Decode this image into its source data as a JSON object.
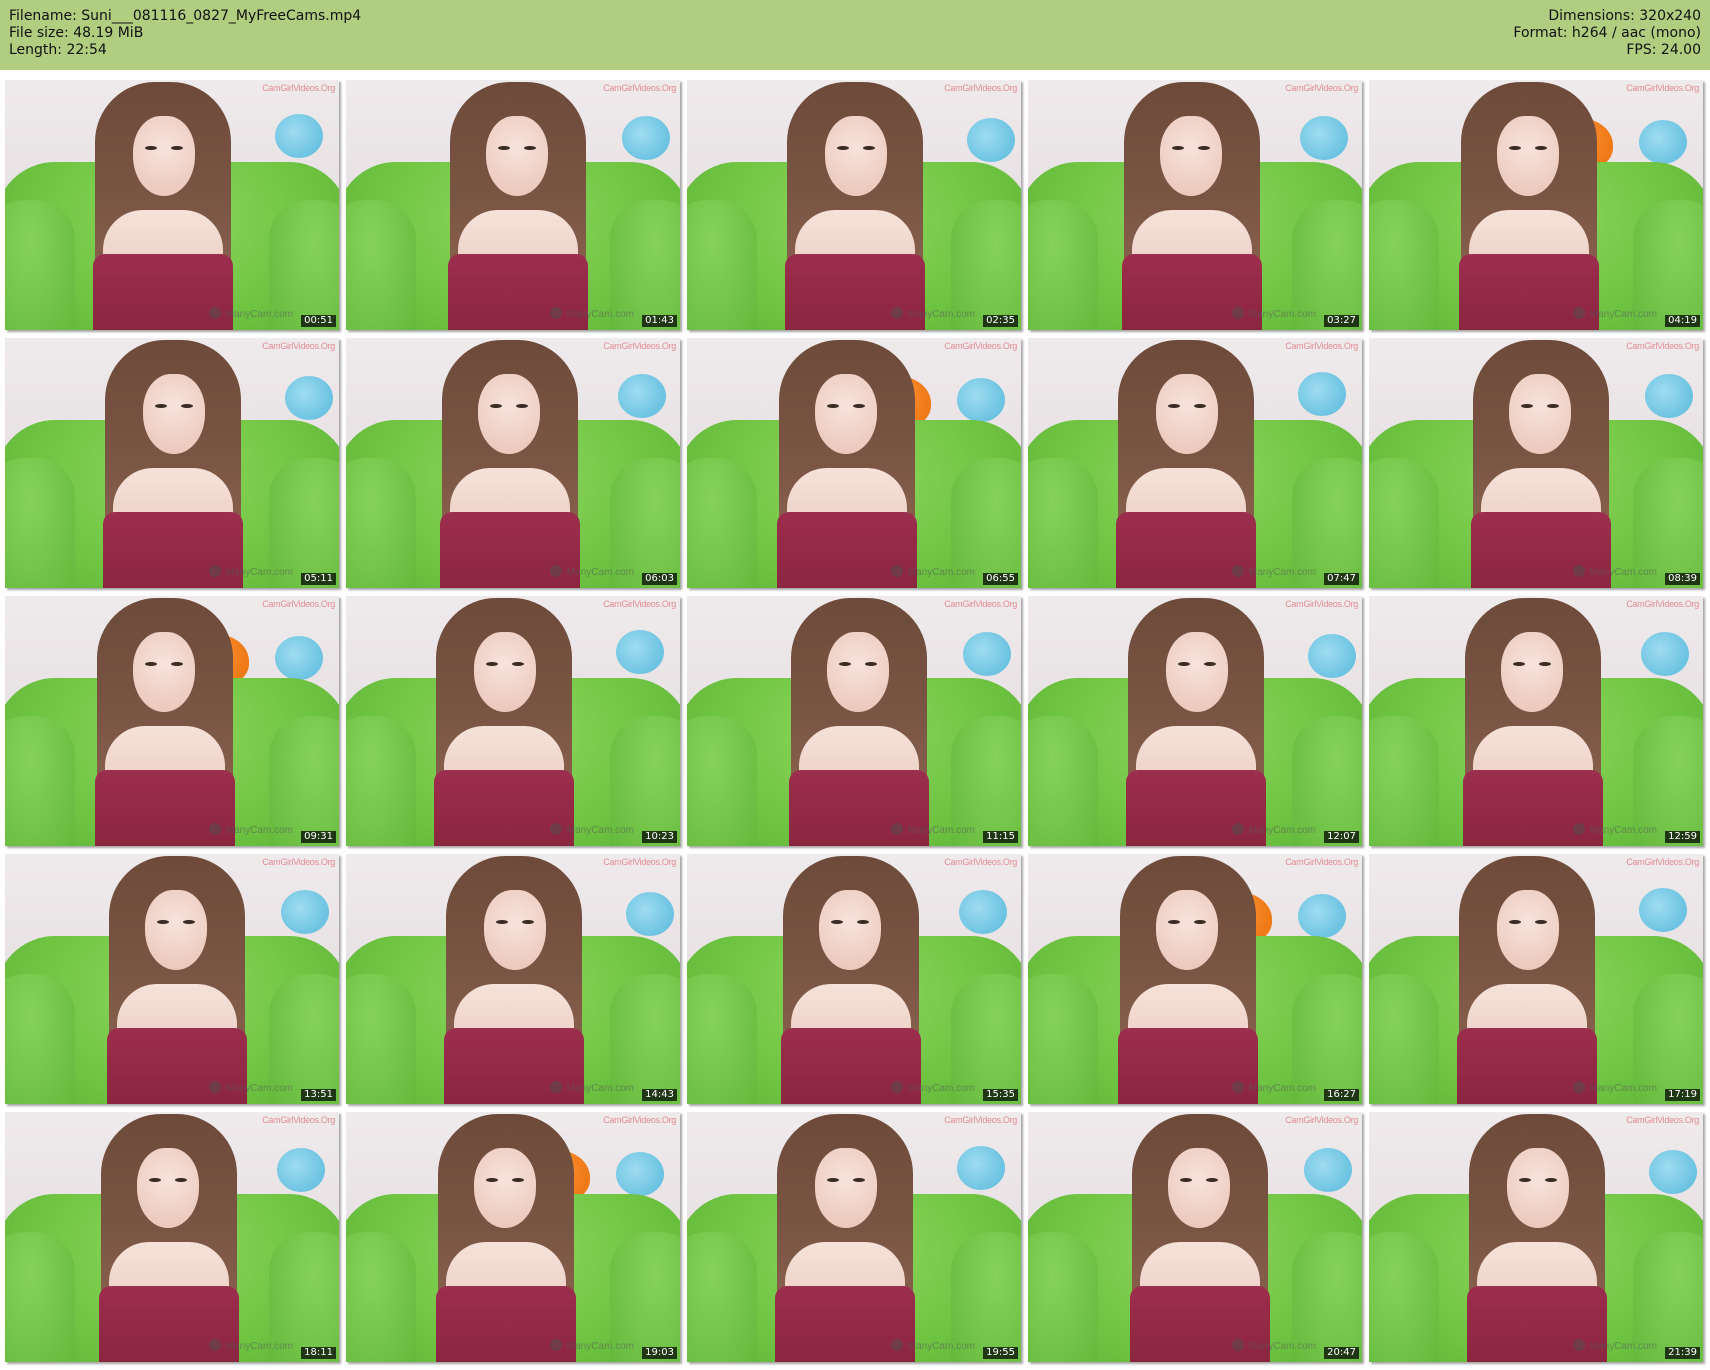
{
  "header": {
    "filename": "Filename: Suni___081116_0827_MyFreeCams.mp4",
    "filesize": "File size: 48.19 MiB",
    "length": "Length: 22:54",
    "dimensions": "Dimensions: 320x240",
    "format": "Format: h264 / aac (mono)",
    "fps": "FPS: 24.00"
  },
  "watermark_top": "CamGirlVideos.Org",
  "watermark_bottom": "ManyCam.com",
  "colors": {
    "header_bg": "#b0cd80",
    "sofa": "#6fc442",
    "top": "#8a2540",
    "pillow_orange": "#f07a18",
    "pillow_blue": "#6cc3e2"
  },
  "thumbnails": [
    {
      "timestamp": "00:51"
    },
    {
      "timestamp": "01:43"
    },
    {
      "timestamp": "02:35"
    },
    {
      "timestamp": "03:27"
    },
    {
      "timestamp": "04:19"
    },
    {
      "timestamp": "05:11"
    },
    {
      "timestamp": "06:03"
    },
    {
      "timestamp": "06:55"
    },
    {
      "timestamp": "07:47"
    },
    {
      "timestamp": "08:39"
    },
    {
      "timestamp": "09:31"
    },
    {
      "timestamp": "10:23"
    },
    {
      "timestamp": "11:15"
    },
    {
      "timestamp": "12:07"
    },
    {
      "timestamp": "12:59"
    },
    {
      "timestamp": "13:51"
    },
    {
      "timestamp": "14:43"
    },
    {
      "timestamp": "15:35"
    },
    {
      "timestamp": "16:27"
    },
    {
      "timestamp": "17:19"
    },
    {
      "timestamp": "18:11"
    },
    {
      "timestamp": "19:03"
    },
    {
      "timestamp": "19:55"
    },
    {
      "timestamp": "20:47"
    },
    {
      "timestamp": "21:39"
    }
  ]
}
